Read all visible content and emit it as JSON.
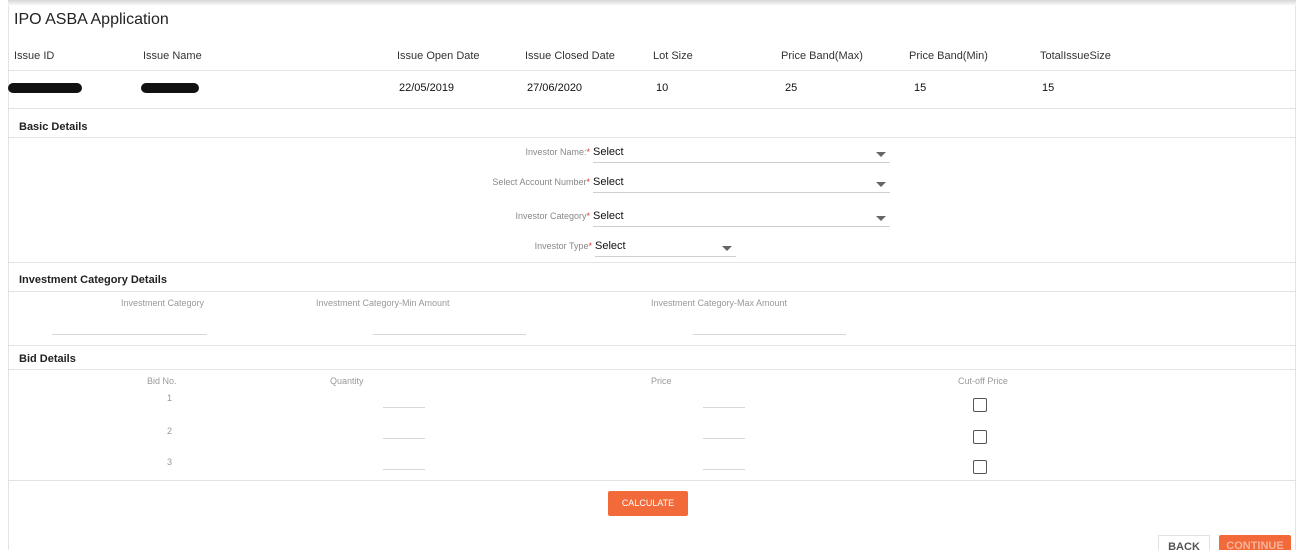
{
  "page": {
    "title": "IPO ASBA Application"
  },
  "issue": {
    "headers": [
      "Issue ID",
      "Issue Name",
      "Issue Open Date",
      "Issue Closed Date",
      "Lot Size",
      "Price Band(Max)",
      "Price Band(Min)",
      "TotalIssueSize"
    ],
    "row": {
      "issue_open_date": "22/05/2019",
      "issue_closed_date": "27/06/2020",
      "lot_size": "10",
      "price_band_max": "25",
      "price_band_min": "15",
      "total_issue_size": "15"
    }
  },
  "basic_details": {
    "title": "Basic Details",
    "fields": [
      {
        "label": "Investor Name:",
        "value": "Select"
      },
      {
        "label": "Select Account Number",
        "value": "Select"
      },
      {
        "label": "Investor Category",
        "value": "Select"
      },
      {
        "label": "Investor Type",
        "value": "Select"
      }
    ],
    "required_mark": "*"
  },
  "investment_category": {
    "title": "Investment Category Details",
    "columns": [
      "Investment Category",
      "Investment Category-Min Amount",
      "Investment Category-Max Amount"
    ]
  },
  "bid_details": {
    "title": "Bid Details",
    "columns": [
      "Bid No.",
      "Quantity",
      "Price",
      "Cut-off Price"
    ],
    "rows": [
      "1",
      "2",
      "3"
    ]
  },
  "actions": {
    "calculate": "CALCULATE",
    "back": "BACK",
    "continue": "CONTINUE"
  },
  "colors": {
    "accent": "#f26a3a",
    "required": "#dd3333"
  }
}
